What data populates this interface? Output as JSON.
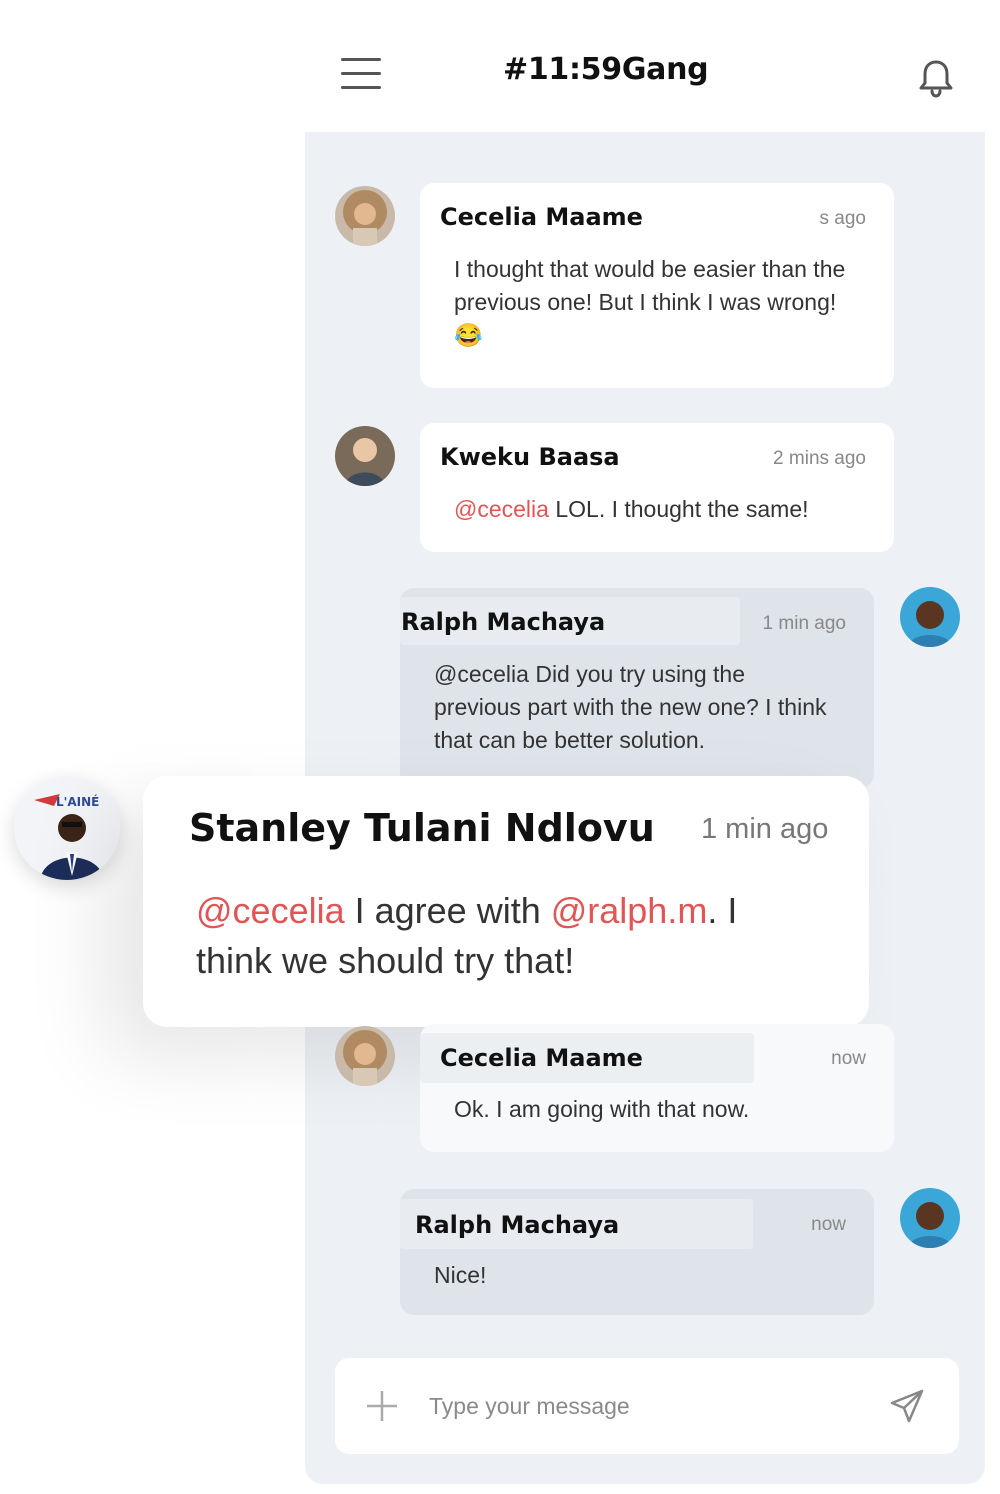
{
  "header": {
    "title": "#11:59Gang"
  },
  "messages": [
    {
      "author": "Cecelia Maame",
      "time": "s ago",
      "text": "I thought that would be easier than the previous one! But I think I was wrong! 😂"
    },
    {
      "author": "Kweku Baasa",
      "time": "2 mins ago",
      "mention": "@cecelia",
      "text": " LOL. I thought the same!"
    },
    {
      "author": "Ralph Machaya",
      "time": "1 min ago",
      "text": "@cecelia Did you try using the previous part with the new one? I think that can be better solution."
    },
    {
      "author": "Cecelia Maame",
      "time": "now",
      "text": "Ok. I am going with that now."
    },
    {
      "author": "Ralph Machaya",
      "time": "now",
      "text": "Nice!"
    }
  ],
  "highlight": {
    "author": "Stanley Tulani Ndlovu",
    "time": "1 min ago",
    "mention1": "@cecelia",
    "text1": " I agree with ",
    "mention2": "@ralph.m",
    "text2": ". I think we should try that!",
    "badge_text": "L'AINÉ"
  },
  "composer": {
    "placeholder": "Type your message"
  },
  "colors": {
    "mention": "#e05555",
    "panel": "#edf1f5",
    "self_bubble": "#dfe4ea"
  },
  "icons": [
    "menu-icon",
    "bell-icon",
    "plus-icon",
    "send-icon"
  ]
}
